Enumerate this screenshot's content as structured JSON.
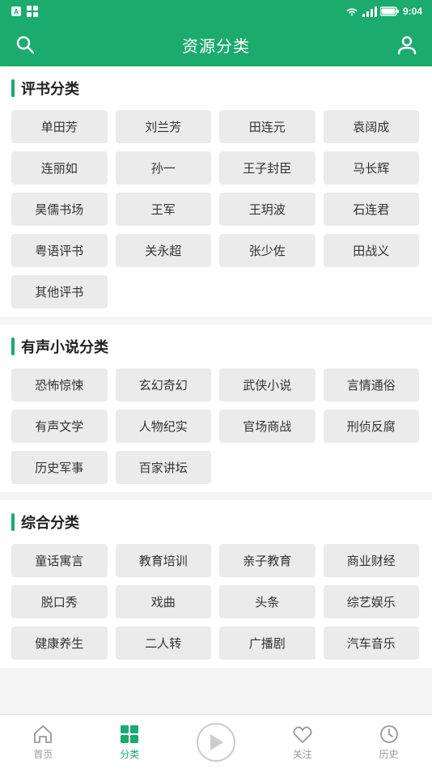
{
  "statusBar": {
    "leftText": "A",
    "time": "9:04"
  },
  "topBar": {
    "title": "资源分类",
    "searchLabel": "search",
    "userLabel": "user"
  },
  "sections": [
    {
      "id": "pingshufenlei",
      "title": "评书分类",
      "tags": [
        "单田芳",
        "刘兰芳",
        "田连元",
        "袁阔成",
        "连丽如",
        "孙一",
        "王子封臣",
        "马长辉",
        "昊儒书场",
        "王军",
        "王玥波",
        "石连君",
        "粤语评书",
        "关永超",
        "张少佐",
        "田战义",
        "其他评书"
      ]
    },
    {
      "id": "youshengxiaoshuofenlei",
      "title": "有声小说分类",
      "tags": [
        "恐怖惊悚",
        "玄幻奇幻",
        "武侠小说",
        "言情通俗",
        "有声文学",
        "人物纪实",
        "官场商战",
        "刑侦反腐",
        "历史军事",
        "百家讲坛"
      ]
    },
    {
      "id": "zonghefenlei",
      "title": "综合分类",
      "tags": [
        "童话寓言",
        "教育培训",
        "亲子教育",
        "商业财经",
        "脱口秀",
        "戏曲",
        "头条",
        "综艺娱乐",
        "健康养生",
        "二人转",
        "广播剧",
        "汽车音乐"
      ]
    }
  ],
  "bottomNav": [
    {
      "id": "home",
      "label": "首页",
      "active": false
    },
    {
      "id": "category",
      "label": "分类",
      "active": true
    },
    {
      "id": "play",
      "label": "",
      "active": false
    },
    {
      "id": "follow",
      "label": "关注",
      "active": false
    },
    {
      "id": "history",
      "label": "历史",
      "active": false
    }
  ]
}
